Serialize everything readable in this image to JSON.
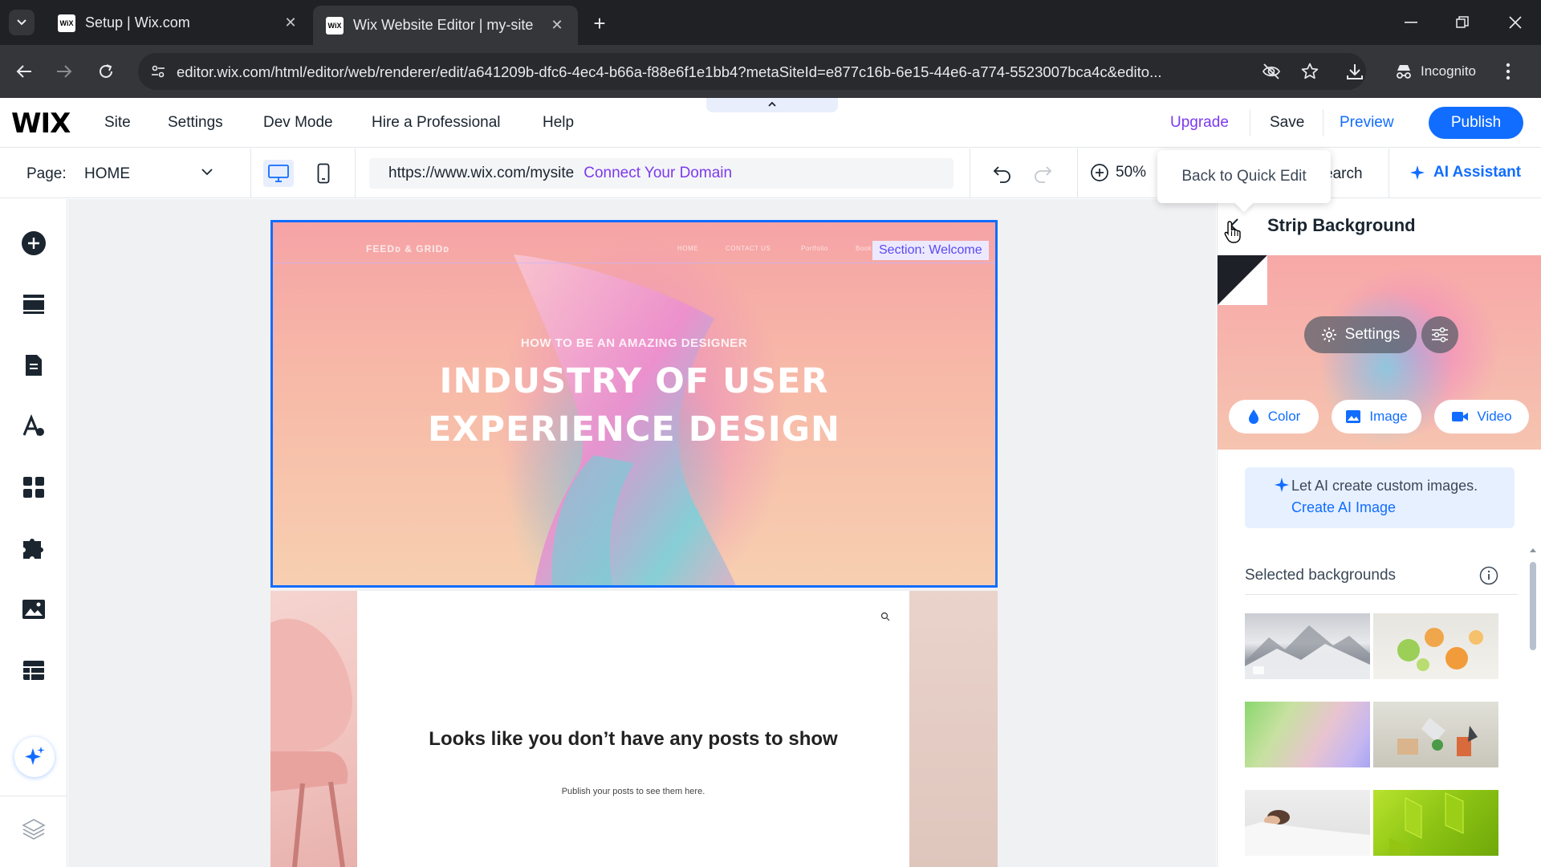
{
  "browser": {
    "tabs": [
      {
        "title": "Setup | Wix.com",
        "favicon": "WiX",
        "active": false
      },
      {
        "title": "Wix Website Editor | my-site",
        "favicon": "WiX",
        "active": true
      }
    ],
    "url": "editor.wix.com/html/editor/web/renderer/edit/a641209b-dfc6-4ec4-b66a-f88e6f1e1bb4?metaSiteId=e877c16b-6e15-44e6-a774-5523007bca4c&edito...",
    "incognito_label": "Incognito",
    "icons": [
      "back-icon",
      "forward-icon",
      "reload-icon",
      "site-info-icon",
      "eye-off-icon",
      "star-icon",
      "download-icon",
      "incognito-icon",
      "kebab-menu-icon"
    ]
  },
  "wix_top": {
    "logo": "WIX",
    "menu": [
      "Site",
      "Settings",
      "Dev Mode",
      "Hire a Professional",
      "Help"
    ],
    "upgrade": "Upgrade",
    "save": "Save",
    "preview": "Preview",
    "publish": "Publish",
    "colors": {
      "upgrade": "#7c3aed",
      "accent": "#116dff"
    }
  },
  "wix_second": {
    "page_label": "Page:",
    "page_name": "HOME",
    "site_url": "https://www.wix.com/mysite",
    "connect_domain": "Connect Your Domain",
    "zoom": "50%",
    "search_fragment": "earch",
    "ai_assistant": "AI Assistant",
    "tooltip": "Back to Quick Edit"
  },
  "left_toolbar": {
    "tools": [
      "add-elements-icon",
      "sections-icon",
      "pages-icon",
      "design-icon",
      "apps-icon",
      "business-apps-icon",
      "media-icon",
      "cms-icon",
      "ai-sparkle-icon",
      "layers-icon"
    ]
  },
  "canvas": {
    "hero": {
      "brand": "FEEDᴅ & GRIDᴅ",
      "nav": [
        "HOME",
        "CONTACT US",
        "Portfolio",
        "Book Online"
      ],
      "kicker": "HOW TO BE AN AMAZING DESIGNER",
      "headline_line1": "INDUSTRY OF USER",
      "headline_line2": "EXPERIENCE DESIGN",
      "section_label": "Section: Welcome"
    },
    "blog": {
      "empty_title": "Looks like you don’t have any posts to show",
      "empty_sub": "Publish your posts to see them here."
    }
  },
  "panel": {
    "title": "Strip Background",
    "settings": "Settings",
    "options": [
      "Color",
      "Image",
      "Video"
    ],
    "ai_text": "Let AI create custom images.",
    "ai_link": "Create AI Image",
    "selected_title": "Selected backgrounds",
    "thumbnails": [
      "snowy-mountain",
      "citrus-fruits",
      "color-gradient",
      "abstract-objects",
      "person-lying",
      "green-geometric"
    ]
  }
}
